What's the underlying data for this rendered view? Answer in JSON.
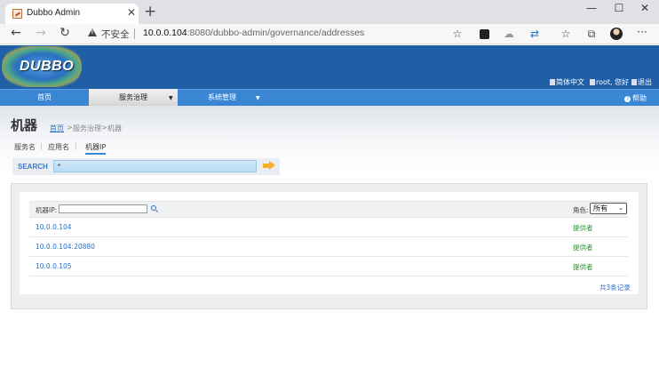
{
  "browser": {
    "tab_title": "Dubbo Admin",
    "tab_close": "✕",
    "new_tab": "+",
    "window_controls": {
      "minimize": "—",
      "maximize": "☐",
      "close": "✕"
    },
    "nav": {
      "back": "←",
      "forward": "→",
      "reload": "↻"
    },
    "security_label": "不安全",
    "url_host": "10.0.0.104",
    "url_rest": ":8080/dubbo-admin/governance/addresses",
    "toolbar_icons": [
      "read-aloud-icon",
      "extension-icon",
      "collections-icon",
      "translate-icon",
      "favorites-icon",
      "collections-list-icon",
      "profile-avatar",
      "more-icon"
    ],
    "more": "···"
  },
  "header": {
    "logo_text": "DUBBO",
    "lang_link": "简体中文",
    "user_link": "root, 您好",
    "logout_link": "退出",
    "brand_color": "#1f5fa5"
  },
  "menu": {
    "items": [
      {
        "label": "首页",
        "active": false
      },
      {
        "label": "服务治理",
        "active": true,
        "arrow": "▼"
      },
      {
        "label": "系统管理",
        "active": false,
        "arrow": "▼"
      }
    ],
    "help": "帮助"
  },
  "page": {
    "title": "机器",
    "breadcrumb": {
      "home": "首页",
      "sep1": ">",
      "section": "服务治理",
      "sep2": ">",
      "current": "机器"
    },
    "subtabs": [
      {
        "label": "服务名",
        "active": false
      },
      {
        "label": "应用名",
        "active": false
      },
      {
        "label": "机器IP",
        "active": true
      }
    ],
    "search": {
      "label": "SEARCH",
      "value": "*"
    }
  },
  "table": {
    "filter_label": "机器IP:",
    "filter_value": "",
    "role_label": "角色:",
    "role_selected": "所有",
    "rows": [
      {
        "ip": "10.0.0.104",
        "role": "提供者"
      },
      {
        "ip": "10.0.0.104:20880",
        "role": "提供者"
      },
      {
        "ip": "10.0.0.105",
        "role": "提供者"
      }
    ],
    "record_count": "共3条记录"
  }
}
